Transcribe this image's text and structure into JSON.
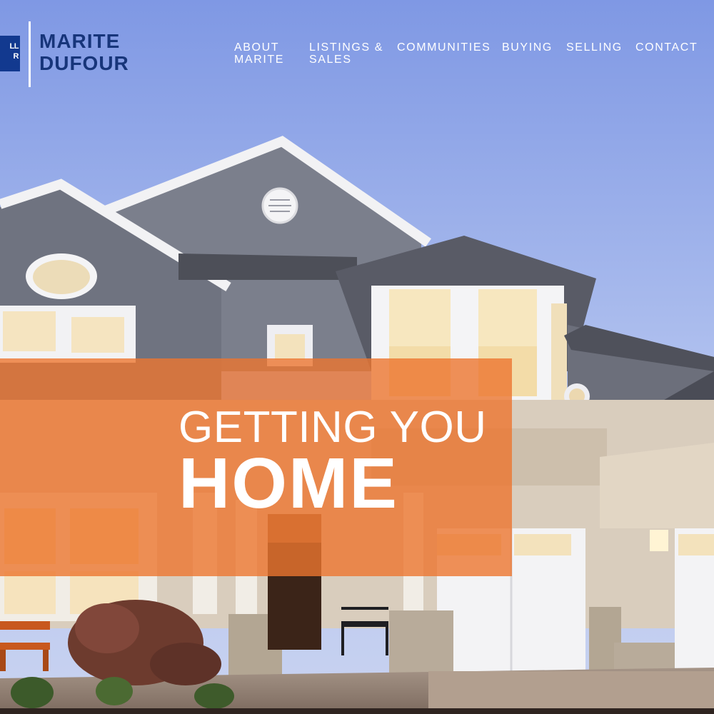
{
  "brand": {
    "badge_line1": "LL",
    "badge_line2": "R",
    "name_first": "MARITE",
    "name_last": "DUFOUR",
    "color": "#17357a",
    "badge_color": "#12398f"
  },
  "nav": {
    "items": [
      {
        "line1": "ABOUT",
        "line2": "MARITE"
      },
      {
        "line1": "LISTINGS &",
        "line2": "SALES"
      },
      {
        "line1": "COMMUNITIES",
        "line2": ""
      },
      {
        "line1": "BUYING",
        "line2": ""
      },
      {
        "line1": "SELLING",
        "line2": ""
      },
      {
        "line1": "CONTACT",
        "line2": ""
      }
    ]
  },
  "hero": {
    "headline_line1": "GETTING YOU",
    "headline_line2": "HOME",
    "overlay_color": "#ec7630",
    "sky_color": "#8fa6e6"
  }
}
